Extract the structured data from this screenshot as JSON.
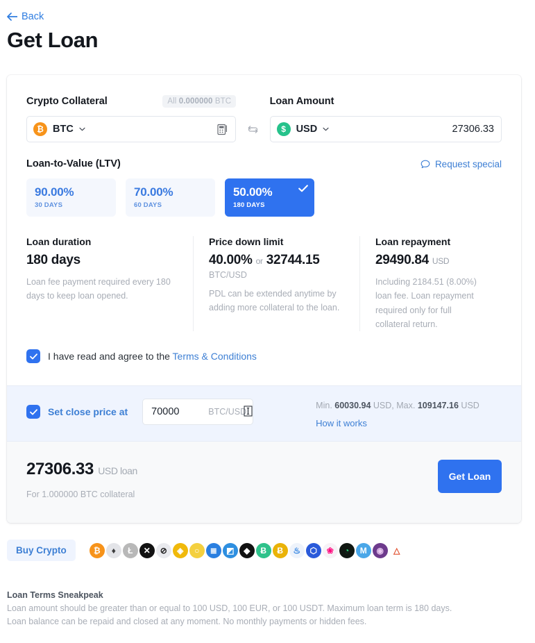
{
  "header": {
    "back_label": "Back",
    "title": "Get Loan"
  },
  "collateral": {
    "label": "Crypto Collateral",
    "all_prefix": "All",
    "all_amount": "0.000000",
    "all_unit": "BTC",
    "currency": "BTC",
    "currency_symbol": "₿",
    "calc_icon": "calculator-icon"
  },
  "swap": {
    "icon": "swap-icon"
  },
  "loan_amount": {
    "label": "Loan Amount",
    "currency": "USD",
    "currency_symbol": "$",
    "value": "27306.33"
  },
  "ltv": {
    "label": "Loan-to-Value (LTV)",
    "request_special": "Request special",
    "options": [
      {
        "percent": "90.00%",
        "days": "30 DAYS",
        "selected": false
      },
      {
        "percent": "70.00%",
        "days": "60 DAYS",
        "selected": false
      },
      {
        "percent": "50.00%",
        "days": "180 DAYS",
        "selected": true
      }
    ]
  },
  "info": {
    "duration": {
      "title": "Loan duration",
      "value": "180 days",
      "note": "Loan fee payment required every 180 days to keep loan opened."
    },
    "pdl": {
      "title": "Price down limit",
      "percent": "40.00%",
      "or": "or",
      "price": "32744.15",
      "pair": "BTC/USD",
      "note": "PDL can be extended anytime by adding more collateral to the loan."
    },
    "repayment": {
      "title": "Loan repayment",
      "value": "29490.84",
      "unit": "USD",
      "note": "Including 2184.51 (8.00%) loan fee. Loan repayment required only for full collateral return."
    }
  },
  "terms": {
    "text": "I have read and agree to the ",
    "link": "Terms & Conditions",
    "checked": true
  },
  "close_price": {
    "label": "Set close price at",
    "value": "70000",
    "suffix": "BTC/USD",
    "checked": true,
    "min_prefix": "Min.",
    "min_value": "60030.94",
    "min_unit": "USD,",
    "max_prefix": "Max.",
    "max_value": "109147.16",
    "max_unit": "USD",
    "how_it_works": "How it works"
  },
  "summary": {
    "amount": "27306.33",
    "amount_unit": "USD loan",
    "sub": "For 1.000000 BTC collateral",
    "button": "Get Loan"
  },
  "buy_crypto": {
    "label": "Buy Crypto",
    "coins": [
      {
        "name": "bitcoin-icon",
        "sym": "₿",
        "bg": "#f7931a",
        "fg": "#ffffff"
      },
      {
        "name": "ethereum-icon",
        "sym": "♦",
        "bg": "#e3e4e8",
        "fg": "#3c3c3d"
      },
      {
        "name": "litecoin-icon",
        "sym": "Ł",
        "bg": "#b8b8b8",
        "fg": "#ffffff"
      },
      {
        "name": "ripple-icon",
        "sym": "✕",
        "bg": "#121212",
        "fg": "#ffffff"
      },
      {
        "name": "stellar-icon",
        "sym": "⊘",
        "bg": "#e9eaee",
        "fg": "#1b1b1b"
      },
      {
        "name": "binance-icon",
        "sym": "◈",
        "bg": "#f0b90b",
        "fg": "#ffffff"
      },
      {
        "name": "chainlink-alt-icon",
        "sym": "○",
        "bg": "#f4d03f",
        "fg": "#ffffff"
      },
      {
        "name": "eos-icon",
        "sym": "≣",
        "bg": "#2a7fe0",
        "fg": "#ffffff"
      },
      {
        "name": "dash-icon",
        "sym": "◩",
        "bg": "#2e8fe0",
        "fg": "#ffffff"
      },
      {
        "name": "tezos-icon",
        "sym": "◆",
        "bg": "#121212",
        "fg": "#ffffff"
      },
      {
        "name": "bitcoincash-icon",
        "sym": "Ƀ",
        "bg": "#2fc28b",
        "fg": "#ffffff"
      },
      {
        "name": "bitcoinsv-icon",
        "sym": "Ƀ",
        "bg": "#eab308",
        "fg": "#ffffff"
      },
      {
        "name": "huobi-icon",
        "sym": "♨",
        "bg": "#eef3fb",
        "fg": "#2a7fe0"
      },
      {
        "name": "chainlink-icon",
        "sym": "⬡",
        "bg": "#2a5ada",
        "fg": "#ffffff"
      },
      {
        "name": "uniswap-icon",
        "sym": "❀",
        "bg": "#f7f2f6",
        "fg": "#ff007a"
      },
      {
        "name": "serum-icon",
        "sym": "◔",
        "bg": "#101712",
        "fg": "#2bd67b"
      },
      {
        "name": "polygon-icon",
        "sym": "Μ",
        "bg": "#4aa7e8",
        "fg": "#ffffff"
      },
      {
        "name": "aave-icon",
        "sym": "◉",
        "bg": "#6d3a8c",
        "fg": "#e8c7f0"
      },
      {
        "name": "basic-attention-icon",
        "sym": "△",
        "bg": "#ffffff",
        "fg": "#e0502f"
      }
    ]
  },
  "footer": {
    "title": "Loan Terms Sneakpeak",
    "line1": "Loan amount should be greater than or equal to 100 USD, 100 EUR, or 100 USDT. Maximum loan term is 180 days.",
    "line2": "Loan balance can be repaid and closed at any moment. No monthly payments or hidden fees."
  }
}
